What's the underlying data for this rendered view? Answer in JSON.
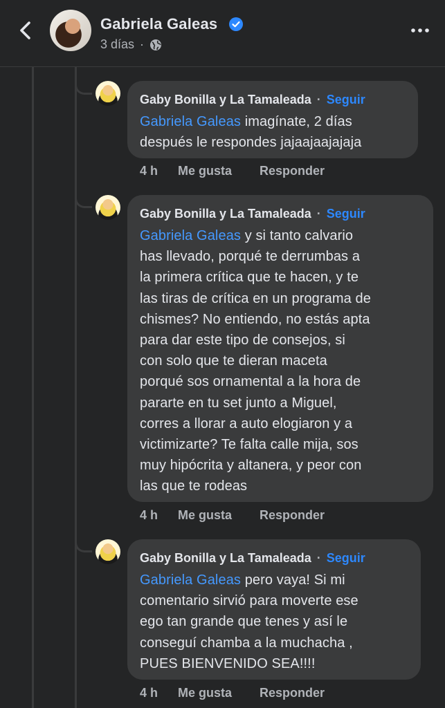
{
  "header": {
    "back_icon": "chevron-left-icon",
    "author_name": "Gabriela Galeas",
    "verified_icon": "verified-badge-icon",
    "time": "3 días",
    "separator": "·",
    "privacy_icon": "globe-icon",
    "more_icon": "more-horizontal-icon"
  },
  "comments": [
    {
      "author": "Gaby Bonilla y La Tamaleada",
      "separator": "·",
      "follow_label": "Seguir",
      "mention": "Gabriela Galeas",
      "lines": [
        " imagínate,  2 días",
        "después le respondes jajaajaajajaja"
      ],
      "time": "4 h",
      "like_label": "Me gusta",
      "reply_label": "Responder"
    },
    {
      "author": "Gaby Bonilla y La Tamaleada",
      "separator": "·",
      "follow_label": "Seguir",
      "mention": "Gabriela Galeas",
      "lines": [
        " y si tanto calvario",
        "has llevado, porqué  te derrumbas a",
        "la primera crítica que te hacen, y te",
        "las tiras de crítica en un programa de",
        "chismes? No entiendo, no estás apta",
        "para dar este tipo de consejos, si",
        "con solo que te dieran maceta",
        "porqué sos ornamental a la hora de",
        "pararte en tu set junto a Miguel,",
        "corres a llorar a auto elogiaron y a",
        "victimizarte? Te falta calle mija, sos",
        "muy hipócrita y altanera, y peor con",
        "las que te rodeas"
      ],
      "time": "4 h",
      "like_label": "Me gusta",
      "reply_label": "Responder"
    },
    {
      "author": "Gaby Bonilla y La Tamaleada",
      "separator": "·",
      "follow_label": "Seguir",
      "mention": "Gabriela Galeas",
      "lines": [
        " pero vaya! Si mi",
        "comentario sirvió para moverte ese",
        "ego tan grande que tenes y así le",
        "conseguí chamba a la muchacha  ,",
        "PUES BIENVENIDO SEA!!!!"
      ],
      "time": "4 h",
      "like_label": "Me gusta",
      "reply_label": "Responder"
    }
  ],
  "colors": {
    "background": "#242526",
    "bubble": "#3a3b3c",
    "link": "#2d88ff",
    "secondary_text": "#b0b3b8"
  }
}
